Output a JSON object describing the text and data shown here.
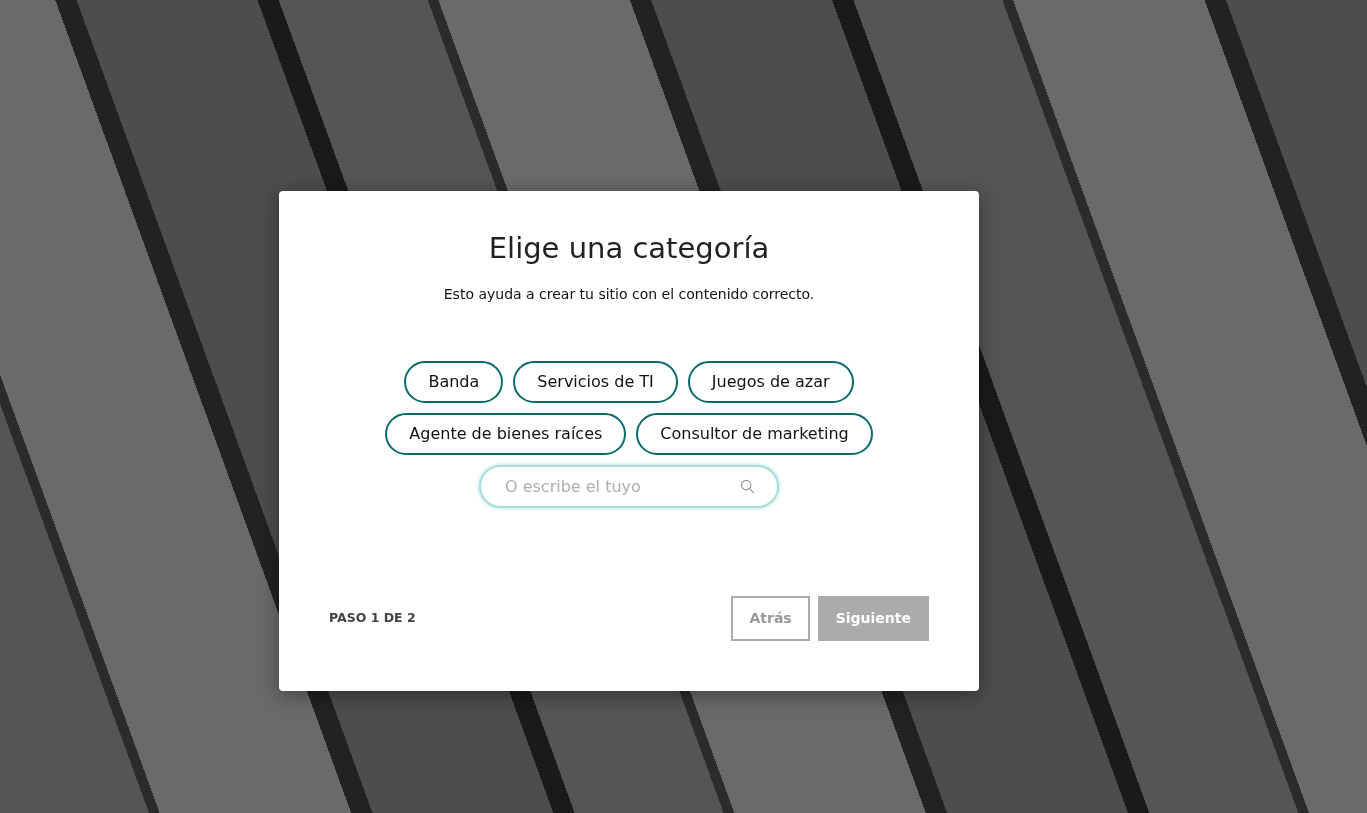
{
  "dialog": {
    "title": "Elige una categoría",
    "subtitle": "Esto ayuda a crear tu sitio con el contenido correcto.",
    "categories": [
      {
        "label": "Banda",
        "selected": false
      },
      {
        "label": "Servicios de TI",
        "selected": false
      },
      {
        "label": "Juegos de azar",
        "selected": false
      },
      {
        "label": "Agente de bienes raíces",
        "selected": false
      },
      {
        "label": "Consultor de marketing",
        "selected": false
      }
    ],
    "search": {
      "placeholder": "O escribe el tuyo"
    },
    "step": "PASO 1 DE 2",
    "buttons": [
      {
        "label": "Atrás",
        "kind": "outline",
        "disabled": true
      },
      {
        "label": "Siguiente",
        "kind": "primary",
        "disabled": true
      }
    ]
  }
}
